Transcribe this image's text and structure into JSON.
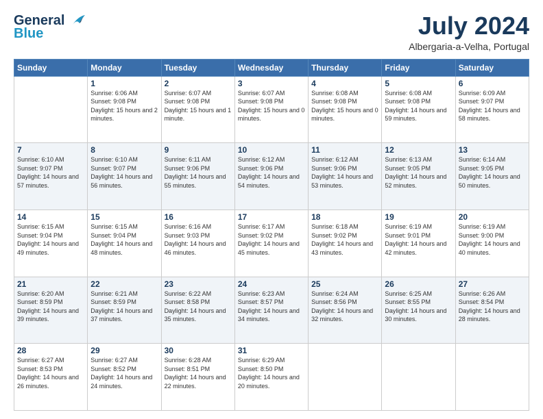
{
  "header": {
    "logo_line1": "General",
    "logo_line2": "Blue",
    "month_title": "July 2024",
    "location": "Albergaria-a-Velha, Portugal"
  },
  "weekdays": [
    "Sunday",
    "Monday",
    "Tuesday",
    "Wednesday",
    "Thursday",
    "Friday",
    "Saturday"
  ],
  "weeks": [
    [
      {
        "day": "",
        "sunrise": "",
        "sunset": "",
        "daylight": ""
      },
      {
        "day": "1",
        "sunrise": "Sunrise: 6:06 AM",
        "sunset": "Sunset: 9:08 PM",
        "daylight": "Daylight: 15 hours and 2 minutes."
      },
      {
        "day": "2",
        "sunrise": "Sunrise: 6:07 AM",
        "sunset": "Sunset: 9:08 PM",
        "daylight": "Daylight: 15 hours and 1 minute."
      },
      {
        "day": "3",
        "sunrise": "Sunrise: 6:07 AM",
        "sunset": "Sunset: 9:08 PM",
        "daylight": "Daylight: 15 hours and 0 minutes."
      },
      {
        "day": "4",
        "sunrise": "Sunrise: 6:08 AM",
        "sunset": "Sunset: 9:08 PM",
        "daylight": "Daylight: 15 hours and 0 minutes."
      },
      {
        "day": "5",
        "sunrise": "Sunrise: 6:08 AM",
        "sunset": "Sunset: 9:08 PM",
        "daylight": "Daylight: 14 hours and 59 minutes."
      },
      {
        "day": "6",
        "sunrise": "Sunrise: 6:09 AM",
        "sunset": "Sunset: 9:07 PM",
        "daylight": "Daylight: 14 hours and 58 minutes."
      }
    ],
    [
      {
        "day": "7",
        "sunrise": "Sunrise: 6:10 AM",
        "sunset": "Sunset: 9:07 PM",
        "daylight": "Daylight: 14 hours and 57 minutes."
      },
      {
        "day": "8",
        "sunrise": "Sunrise: 6:10 AM",
        "sunset": "Sunset: 9:07 PM",
        "daylight": "Daylight: 14 hours and 56 minutes."
      },
      {
        "day": "9",
        "sunrise": "Sunrise: 6:11 AM",
        "sunset": "Sunset: 9:06 PM",
        "daylight": "Daylight: 14 hours and 55 minutes."
      },
      {
        "day": "10",
        "sunrise": "Sunrise: 6:12 AM",
        "sunset": "Sunset: 9:06 PM",
        "daylight": "Daylight: 14 hours and 54 minutes."
      },
      {
        "day": "11",
        "sunrise": "Sunrise: 6:12 AM",
        "sunset": "Sunset: 9:06 PM",
        "daylight": "Daylight: 14 hours and 53 minutes."
      },
      {
        "day": "12",
        "sunrise": "Sunrise: 6:13 AM",
        "sunset": "Sunset: 9:05 PM",
        "daylight": "Daylight: 14 hours and 52 minutes."
      },
      {
        "day": "13",
        "sunrise": "Sunrise: 6:14 AM",
        "sunset": "Sunset: 9:05 PM",
        "daylight": "Daylight: 14 hours and 50 minutes."
      }
    ],
    [
      {
        "day": "14",
        "sunrise": "Sunrise: 6:15 AM",
        "sunset": "Sunset: 9:04 PM",
        "daylight": "Daylight: 14 hours and 49 minutes."
      },
      {
        "day": "15",
        "sunrise": "Sunrise: 6:15 AM",
        "sunset": "Sunset: 9:04 PM",
        "daylight": "Daylight: 14 hours and 48 minutes."
      },
      {
        "day": "16",
        "sunrise": "Sunrise: 6:16 AM",
        "sunset": "Sunset: 9:03 PM",
        "daylight": "Daylight: 14 hours and 46 minutes."
      },
      {
        "day": "17",
        "sunrise": "Sunrise: 6:17 AM",
        "sunset": "Sunset: 9:02 PM",
        "daylight": "Daylight: 14 hours and 45 minutes."
      },
      {
        "day": "18",
        "sunrise": "Sunrise: 6:18 AM",
        "sunset": "Sunset: 9:02 PM",
        "daylight": "Daylight: 14 hours and 43 minutes."
      },
      {
        "day": "19",
        "sunrise": "Sunrise: 6:19 AM",
        "sunset": "Sunset: 9:01 PM",
        "daylight": "Daylight: 14 hours and 42 minutes."
      },
      {
        "day": "20",
        "sunrise": "Sunrise: 6:19 AM",
        "sunset": "Sunset: 9:00 PM",
        "daylight": "Daylight: 14 hours and 40 minutes."
      }
    ],
    [
      {
        "day": "21",
        "sunrise": "Sunrise: 6:20 AM",
        "sunset": "Sunset: 8:59 PM",
        "daylight": "Daylight: 14 hours and 39 minutes."
      },
      {
        "day": "22",
        "sunrise": "Sunrise: 6:21 AM",
        "sunset": "Sunset: 8:59 PM",
        "daylight": "Daylight: 14 hours and 37 minutes."
      },
      {
        "day": "23",
        "sunrise": "Sunrise: 6:22 AM",
        "sunset": "Sunset: 8:58 PM",
        "daylight": "Daylight: 14 hours and 35 minutes."
      },
      {
        "day": "24",
        "sunrise": "Sunrise: 6:23 AM",
        "sunset": "Sunset: 8:57 PM",
        "daylight": "Daylight: 14 hours and 34 minutes."
      },
      {
        "day": "25",
        "sunrise": "Sunrise: 6:24 AM",
        "sunset": "Sunset: 8:56 PM",
        "daylight": "Daylight: 14 hours and 32 minutes."
      },
      {
        "day": "26",
        "sunrise": "Sunrise: 6:25 AM",
        "sunset": "Sunset: 8:55 PM",
        "daylight": "Daylight: 14 hours and 30 minutes."
      },
      {
        "day": "27",
        "sunrise": "Sunrise: 6:26 AM",
        "sunset": "Sunset: 8:54 PM",
        "daylight": "Daylight: 14 hours and 28 minutes."
      }
    ],
    [
      {
        "day": "28",
        "sunrise": "Sunrise: 6:27 AM",
        "sunset": "Sunset: 8:53 PM",
        "daylight": "Daylight: 14 hours and 26 minutes."
      },
      {
        "day": "29",
        "sunrise": "Sunrise: 6:27 AM",
        "sunset": "Sunset: 8:52 PM",
        "daylight": "Daylight: 14 hours and 24 minutes."
      },
      {
        "day": "30",
        "sunrise": "Sunrise: 6:28 AM",
        "sunset": "Sunset: 8:51 PM",
        "daylight": "Daylight: 14 hours and 22 minutes."
      },
      {
        "day": "31",
        "sunrise": "Sunrise: 6:29 AM",
        "sunset": "Sunset: 8:50 PM",
        "daylight": "Daylight: 14 hours and 20 minutes."
      },
      {
        "day": "",
        "sunrise": "",
        "sunset": "",
        "daylight": ""
      },
      {
        "day": "",
        "sunrise": "",
        "sunset": "",
        "daylight": ""
      },
      {
        "day": "",
        "sunrise": "",
        "sunset": "",
        "daylight": ""
      }
    ]
  ]
}
